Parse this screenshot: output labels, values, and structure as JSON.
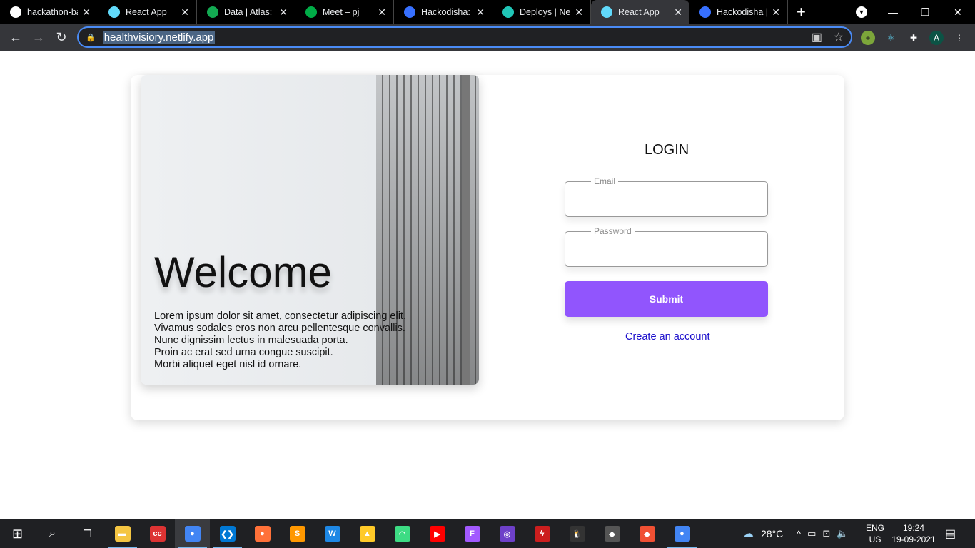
{
  "browser": {
    "tabs": [
      {
        "title": "hackathon-ba",
        "icon": "github-icon",
        "color": "#ffffff"
      },
      {
        "title": "React App",
        "icon": "react-icon",
        "color": "#61dafb"
      },
      {
        "title": "Data | Atlas: M",
        "icon": "mongodb-leaf-icon",
        "color": "#13aa52"
      },
      {
        "title": "Meet – pj",
        "icon": "google-meet-icon",
        "color": "#00ac47"
      },
      {
        "title": "Hackodisha: D",
        "icon": "devfolio-icon",
        "color": "#3770ff"
      },
      {
        "title": "Deploys | Net",
        "icon": "netlify-icon",
        "color": "#20c6b7"
      },
      {
        "title": "React App",
        "icon": "react-icon",
        "color": "#61dafb",
        "active": true
      },
      {
        "title": "Hackodisha | ",
        "icon": "devfolio-icon",
        "color": "#3770ff"
      }
    ],
    "url": "healthvisiory.netlify.app",
    "profile_initial": "A"
  },
  "page": {
    "welcome": "Welcome",
    "lorem": [
      "Lorem ipsum dolor sit amet, consectetur adipiscing elit.",
      "Vivamus sodales eros non arcu pellentesque convallis.",
      "Nunc dignissim lectus in malesuada porta.",
      "Proin ac erat sed urna congue suscipit.",
      "Morbi aliquet eget nisl id ornare."
    ],
    "login_title": "LOGIN",
    "email_label": "Email",
    "email_value": "",
    "password_label": "Password",
    "password_value": "",
    "submit_label": "Submit",
    "create_account": "Create an account",
    "accent_color": "#9155fd"
  },
  "taskbar": {
    "apps": [
      {
        "name": "file-explorer",
        "glyph": "▬",
        "color": "#f4c542"
      },
      {
        "name": "ccleaner",
        "glyph": "cc",
        "color": "#d33"
      },
      {
        "name": "chrome",
        "glyph": "●",
        "color": "#4285f4",
        "active": true
      },
      {
        "name": "vscode",
        "glyph": "❮❯",
        "color": "#0078d4"
      },
      {
        "name": "firefox",
        "glyph": "●",
        "color": "#ff7139"
      },
      {
        "name": "sublime-text",
        "glyph": "S",
        "color": "#ff9800"
      },
      {
        "name": "webstorm",
        "glyph": "W",
        "color": "#1e88e5"
      },
      {
        "name": "firebase",
        "glyph": "▲",
        "color": "#ffca28"
      },
      {
        "name": "android-studio",
        "glyph": "◠",
        "color": "#3ddc84"
      },
      {
        "name": "youtube",
        "glyph": "▶",
        "color": "#ff0000"
      },
      {
        "name": "figma",
        "glyph": "F",
        "color": "#a259ff"
      },
      {
        "name": "github-desktop",
        "glyph": "◎",
        "color": "#6e40c9"
      },
      {
        "name": "flash",
        "glyph": "ϟ",
        "color": "#cc1e1e"
      },
      {
        "name": "linux",
        "glyph": "🐧",
        "color": "#333"
      },
      {
        "name": "unity",
        "glyph": "◆",
        "color": "#555"
      },
      {
        "name": "git",
        "glyph": "◆",
        "color": "#f05033"
      },
      {
        "name": "chrome-2",
        "glyph": "●",
        "color": "#4285f4"
      }
    ],
    "weather": "28°C",
    "lang": "ENG",
    "region": "US",
    "time": "19:24",
    "date": "19-09-2021"
  }
}
